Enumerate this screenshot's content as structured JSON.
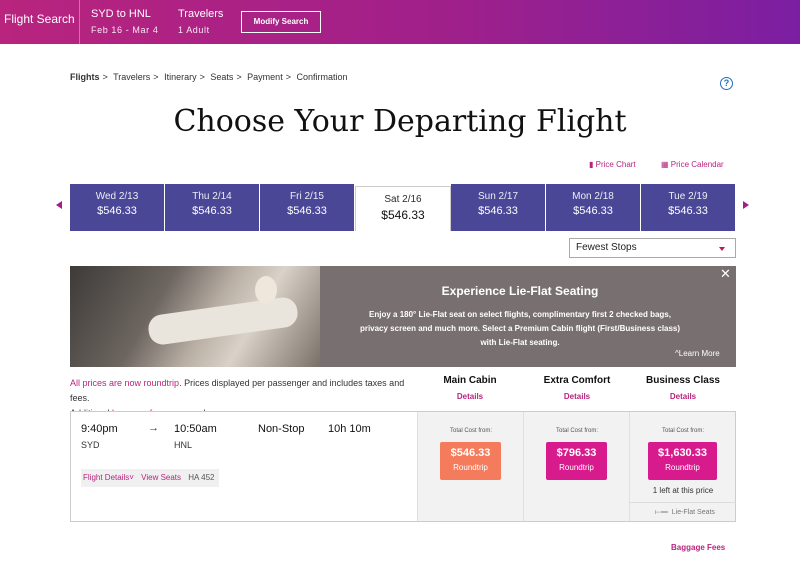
{
  "header": {
    "title": "Flight Search",
    "route": "SYD to HNL",
    "dates": "Feb 16 - Mar 4",
    "travelers_label": "Travelers",
    "travelers_value": "1 Adult",
    "modify_label": "Modify Search"
  },
  "breadcrumb": [
    "Flights",
    "Travelers",
    "Itinerary",
    "Seats",
    "Payment",
    "Confirmation"
  ],
  "page_title": "Choose Your Departing Flight",
  "links": {
    "price_chart": "Price Chart",
    "price_calendar": "Price Calendar"
  },
  "dates": [
    {
      "day": "Wed 2/13",
      "price": "$546.33"
    },
    {
      "day": "Thu 2/14",
      "price": "$546.33"
    },
    {
      "day": "Fri 2/15",
      "price": "$546.33"
    },
    {
      "day": "Sat 2/16",
      "price": "$546.33"
    },
    {
      "day": "Sun 2/17",
      "price": "$546.33"
    },
    {
      "day": "Mon 2/18",
      "price": "$546.33"
    },
    {
      "day": "Tue 2/19",
      "price": "$546.33"
    }
  ],
  "sort": {
    "selected": "Fewest Stops"
  },
  "banner": {
    "title": "Experience Lie-Flat Seating",
    "text": "Enjoy a 180° Lie-Flat seat on select flights, complimentary first 2 checked bags, privacy screen and much more. Select a Premium Cabin flight (First/Business class) with Lie-Flat seating.",
    "learn_more": "Learn More",
    "close": "✕"
  },
  "note": {
    "roundtrip_link": "All prices are now roundtrip",
    "text1": ". Prices displayed per passenger and includes taxes and fees.",
    "text2": "Additional ",
    "baggage_link": "baggage fees",
    "text3": " may apply."
  },
  "cabins": [
    {
      "name": "Main Cabin",
      "details": "Details"
    },
    {
      "name": "Extra Comfort",
      "details": "Details"
    },
    {
      "name": "Business Class",
      "details": "Details"
    }
  ],
  "flight": {
    "depart_time": "9:40pm",
    "depart_code": "SYD",
    "arrow": "→",
    "arrive_time": "10:50am",
    "arrive_code": "HNL",
    "stops": "Non-Stop",
    "duration": "10h 10m",
    "details_link": "Flight Details",
    "seats_link": "View Seats",
    "flight_number": "HA 452"
  },
  "fares": [
    {
      "label": "Total Cost from:",
      "amount": "$546.33",
      "roundtrip": "Roundtrip",
      "color": "#f47c5c"
    },
    {
      "label": "Total Cost from:",
      "amount": "$796.33",
      "roundtrip": "Roundtrip",
      "color": "#d81b8c"
    },
    {
      "label": "Total Cost from:",
      "amount": "$1,630.33",
      "roundtrip": "Roundtrip",
      "color": "#d81b8c",
      "left": "1 left at this price",
      "feature": "Lie-Flat Seats"
    }
  ],
  "baggage_fees": "Baggage Fees",
  "colors": {
    "brand": "#b8247e",
    "date_bar": "#4a4797"
  }
}
